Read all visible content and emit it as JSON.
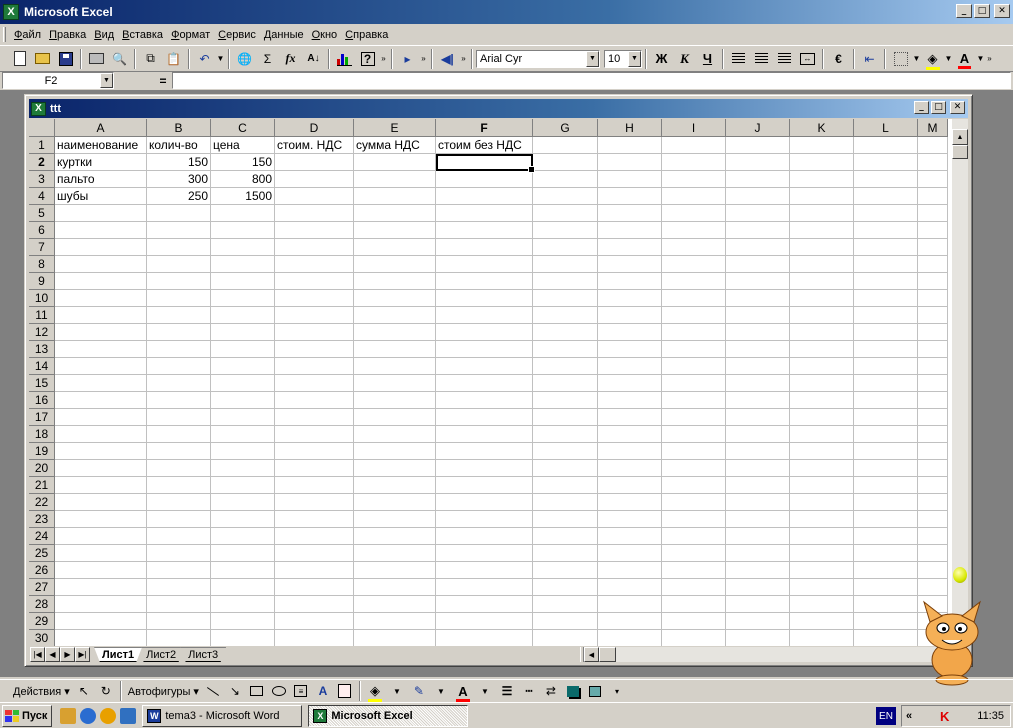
{
  "window": {
    "title": "Microsoft Excel",
    "app_icon": "X"
  },
  "menu": [
    "Файл",
    "Правка",
    "Вид",
    "Вставка",
    "Формат",
    "Сервис",
    "Данные",
    "Окно",
    "Справка"
  ],
  "toolbar": {
    "font_name": "Arial Cyr",
    "font_size": "10",
    "bold": "Ж",
    "italic": "К",
    "underline": "Ч",
    "sum": "Σ",
    "fx": "fx",
    "font_color": "A"
  },
  "formula_bar": {
    "name_box": "F2",
    "equals": "=",
    "value": ""
  },
  "workbook": {
    "title": "ttt",
    "columns": [
      {
        "label": "A"
      },
      {
        "label": "B"
      },
      {
        "label": "C"
      },
      {
        "label": "D"
      },
      {
        "label": "E"
      },
      {
        "label": "F"
      },
      {
        "label": "G"
      },
      {
        "label": "H"
      },
      {
        "label": "I"
      },
      {
        "label": "J"
      },
      {
        "label": "K"
      },
      {
        "label": "L"
      },
      {
        "label": "M"
      }
    ],
    "active_cell": {
      "col": "F",
      "row": 2
    },
    "row_count": 30,
    "cells": {
      "A1": "наименование",
      "B1": "колич-во",
      "C1": "цена",
      "D1": "стоим. НДС",
      "E1": "сумма НДС",
      "F1": "стоим без НДС",
      "A2": "куртки",
      "B2": "150",
      "C2": "150",
      "A3": "пальто",
      "B3": "300",
      "C3": "800",
      "A4": "шубы",
      "B4": "250",
      "C4": "1500"
    },
    "sheets": [
      {
        "name": "Лист1",
        "active": true
      },
      {
        "name": "Лист2",
        "active": false
      },
      {
        "name": "Лист3",
        "active": false
      }
    ]
  },
  "drawing_toolbar": {
    "actions": "Действия",
    "autoshapes": "Автофигуры"
  },
  "taskbar": {
    "start": "Пуск",
    "tasks": [
      {
        "label": "tema3 - Microsoft Word",
        "icon": "W",
        "active": false
      },
      {
        "label": "Microsoft Excel",
        "icon": "X",
        "active": true
      }
    ],
    "language": "EN",
    "tray_chevron": "«",
    "clock": "11:35"
  },
  "icons": {
    "new": "new-document-icon",
    "open": "open-folder-icon",
    "save": "save-icon",
    "print": "print-icon",
    "preview": "print-preview-icon",
    "copy": "copy-icon",
    "paste": "paste-icon",
    "undo": "undo-icon",
    "web": "web-icon",
    "sort": "sort-icon",
    "chart": "chart-wizard-icon",
    "help": "help-icon"
  }
}
